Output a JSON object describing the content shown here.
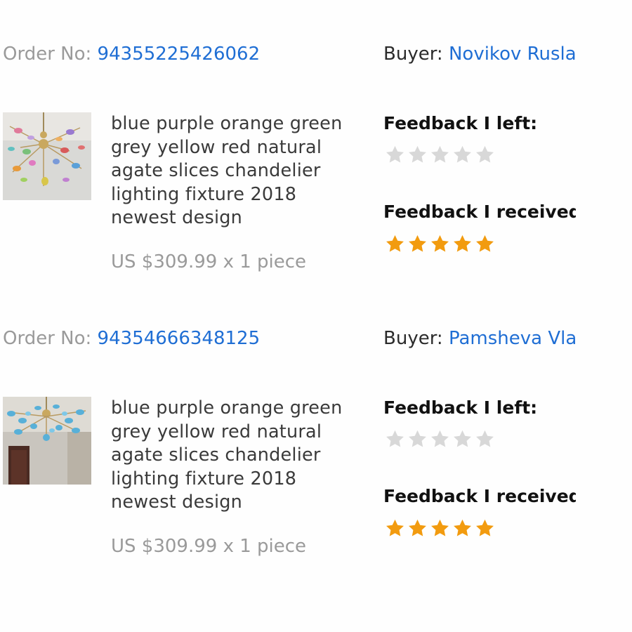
{
  "colors": {
    "link": "#1f6ed4",
    "muted_text": "#9a9a9a",
    "star_filled": "#f29b0f",
    "star_empty": "#d8d8d8"
  },
  "orders": [
    {
      "order_no_label": "Order No:",
      "order_no": "94355225426062",
      "buyer_label": "Buyer:",
      "buyer_name": "Novikov Rusla",
      "product_title": "blue purple orange green grey yellow red natural agate slices chandelier lighting fixture 2018 newest design",
      "price_text": "US $309.99 x 1 piece",
      "feedback_left_label": "Feedback I left:",
      "feedback_left_stars": 0,
      "feedback_received_label": "Feedback I received:",
      "feedback_received_stars": 5
    },
    {
      "order_no_label": "Order No:",
      "order_no": "94354666348125",
      "buyer_label": "Buyer:",
      "buyer_name": "Pamsheva Vla",
      "product_title": "blue purple orange green grey yellow red natural agate slices chandelier lighting fixture 2018 newest design",
      "price_text": "US $309.99 x 1 piece",
      "feedback_left_label": "Feedback I left:",
      "feedback_left_stars": 0,
      "feedback_received_label": "Feedback I received:",
      "feedback_received_stars": 5
    }
  ]
}
